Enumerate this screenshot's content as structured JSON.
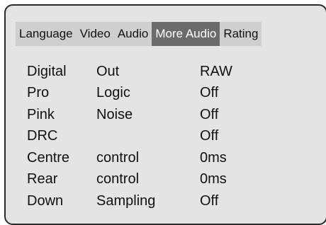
{
  "tabs": [
    {
      "label": "Language"
    },
    {
      "label": "Video"
    },
    {
      "label": "Audio"
    },
    {
      "label": "More Audio",
      "active": true
    },
    {
      "label": "Rating"
    }
  ],
  "settings": [
    {
      "word1": "Digital",
      "word2": "Out",
      "value": "RAW"
    },
    {
      "word1": "Pro",
      "word2": "Logic",
      "value": "Off"
    },
    {
      "word1": "Pink",
      "word2": "Noise",
      "value": "Off"
    },
    {
      "word1": "DRC",
      "word2": "",
      "value": "Off"
    },
    {
      "word1": "Centre",
      "word2": "control",
      "value": "0ms"
    },
    {
      "word1": "Rear",
      "word2": "control",
      "value": "0ms"
    },
    {
      "word1": "Down",
      "word2": "Sampling",
      "value": "Off"
    }
  ],
  "colors": {
    "panel_background": "#e4e4e4",
    "tabbar_background": "#cfcfcf",
    "active_tab_background": "#6b6b6b",
    "active_tab_text": "#ffffff"
  }
}
